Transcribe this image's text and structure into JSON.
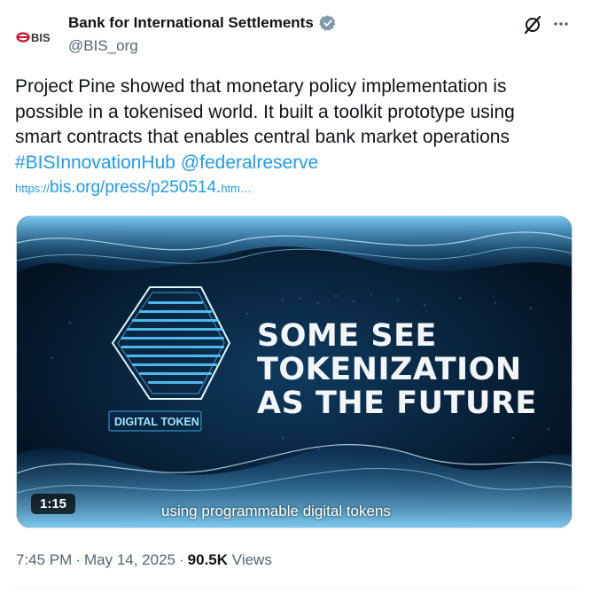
{
  "author": {
    "name": "Bank for International Settlements",
    "handle": "@BIS_org",
    "avatar_text": "BIS",
    "verified_icon": "verified-badge-icon",
    "verified_color": "#829aab"
  },
  "actions": {
    "grok_icon": "grok-icon",
    "more_icon": "more-dots-icon"
  },
  "tweet": {
    "line1": "Project Pine showed that monetary policy implementation is",
    "line2": "possible in a tokenised world. It built a toolkit prototype using",
    "line3": "smart contracts that enables central bank market operations",
    "hashtag": "#BISInnovationHub",
    "mention": "@federalreserve",
    "url_prefix": "https://",
    "url_main": "bis.org/press/p250514.",
    "url_suffix": "htm…",
    "link_color": "#1d9bf0"
  },
  "media": {
    "headline_line1": "SOME SEE",
    "headline_line2": "TOKENIZATION",
    "headline_line3": "AS THE FUTURE",
    "token_label": "DIGITAL TOKEN",
    "caption": "using programmable digital tokens",
    "duration": "1:15"
  },
  "meta": {
    "time": "7:45 PM",
    "date": "May 14, 2025",
    "views_count": "90.5K",
    "views_label": "Views"
  }
}
